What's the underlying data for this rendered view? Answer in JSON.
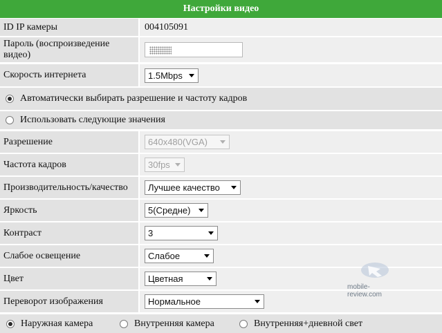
{
  "title": "Настройки видео",
  "camera_id": {
    "label": "ID IP камеры",
    "value": "004105091"
  },
  "password": {
    "label": "Пароль (воспроизведение видео)"
  },
  "speed": {
    "label": "Скорость интернета",
    "value": "1.5Mbps"
  },
  "auto_option": {
    "label": "Автоматически выбирать разрешение и частоту кадров",
    "checked": true
  },
  "manual_option": {
    "label": "Использовать следующие значения",
    "checked": false
  },
  "resolution": {
    "label": "Разрешение",
    "value": "640x480(VGA)",
    "disabled": true
  },
  "framerate": {
    "label": "Частота кадров",
    "value": "30fps",
    "disabled": true
  },
  "quality": {
    "label": "Производительность/качество",
    "value": "Лучшее качество"
  },
  "brightness": {
    "label": "Яркость",
    "value": "5(Средне)"
  },
  "contrast": {
    "label": "Контраст",
    "value": "3"
  },
  "low_light": {
    "label": "Слабое освещение",
    "value": "Слабое"
  },
  "color": {
    "label": "Цвет",
    "value": "Цветная"
  },
  "flip": {
    "label": "Переворот изображения",
    "value": "Нормальное"
  },
  "environment": {
    "options": [
      {
        "label": "Наружная камера",
        "checked": true
      },
      {
        "label": "Внутренняя камера",
        "checked": false
      },
      {
        "label": "Внутренняя+дневной свет",
        "checked": false
      }
    ]
  },
  "watermark": {
    "text": "mobile-review.com"
  },
  "colors": {
    "header": "#3fa83a",
    "label_bg": "#e2e2e2",
    "value_bg": "#efefef"
  }
}
